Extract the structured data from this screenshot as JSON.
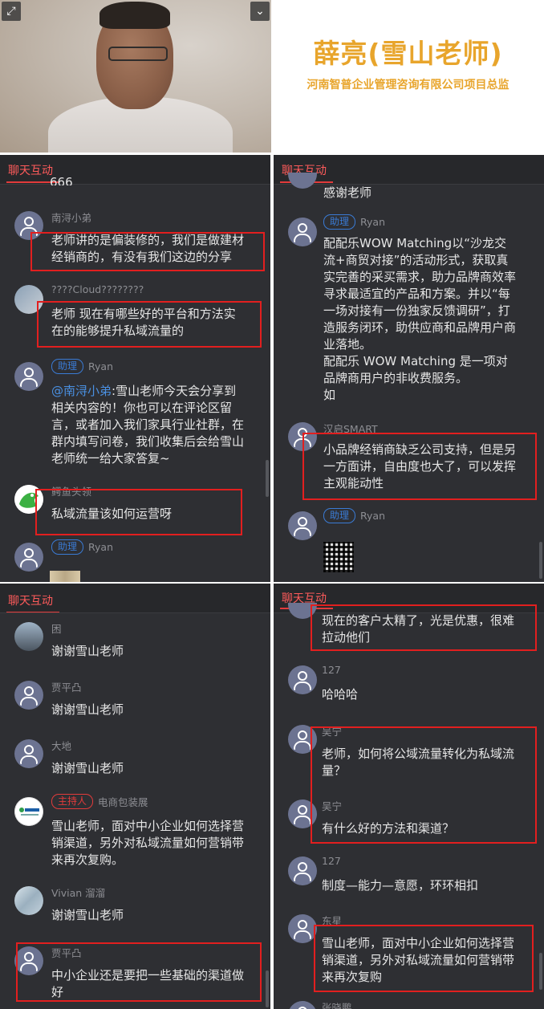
{
  "video": {
    "expand_icon": "⤢",
    "collapse_icon": "⌄"
  },
  "title": {
    "name": "薛亮(雪山老师)",
    "subtitle": "河南智普企业管理咨询有限公司项目总监"
  },
  "panel_label": "聊天互动",
  "panel1": {
    "partial_top": "666",
    "messages": [
      {
        "user": "南浔小弟",
        "text": [
          "老师讲的是偏装修的，我们是做建材",
          "经销商的，有没有我们这边的分享"
        ]
      },
      {
        "user": "????Cloud????????",
        "text": [
          "老师 现在有哪些好的平台和方法实",
          "在的能够提升私域流量的"
        ]
      },
      {
        "badge": "助理",
        "user": "Ryan",
        "mention": "@南浔小弟",
        "text_first": ":雪山老师今天会分享到",
        "text": [
          "相关内容的！你也可以在评论区留",
          "言，或者加入我们家具行业社群，在",
          "群内填写问卷，我们收集后会给雪山",
          "老师统一给大家答复~"
        ]
      },
      {
        "user": "鳄鱼头领",
        "text": [
          "私域流量该如何运营呀"
        ]
      },
      {
        "badge": "助理",
        "user": "Ryan"
      }
    ]
  },
  "panel2": {
    "partial_top": "感谢老师",
    "messages": [
      {
        "badge": "助理",
        "user": "Ryan",
        "text": [
          "配配乐WOW Matching以“沙龙交",
          "流+商贸对接”的活动形式，获取真",
          "实完善的采买需求，助力品牌商效率",
          "寻求最适宜的产品和方案。并以“每",
          "一场对接有一份独家反馈调研”，打",
          "造服务闭环，助供应商和品牌用户商",
          "业落地。",
          "配配乐 WOW Matching 是一项对",
          "品牌商用户的非收费服务。",
          "如"
        ]
      },
      {
        "user": "汉启SMART",
        "text": [
          "小品牌经销商缺乏公司支持，但是另",
          "一方面讲，自由度也大了，可以发挥",
          "主观能动性"
        ]
      },
      {
        "badge": "助理",
        "user": "Ryan"
      }
    ]
  },
  "panel3": {
    "messages": [
      {
        "user": "困",
        "text": [
          "谢谢雪山老师"
        ]
      },
      {
        "user": "贾平凸",
        "text": [
          "谢谢雪山老师"
        ]
      },
      {
        "user": "大地",
        "text": [
          "谢谢雪山老师"
        ]
      },
      {
        "badge": "主持人",
        "user": "电商包装展",
        "text": [
          "雪山老师，面对中小企业如何选择营",
          "销渠道，另外对私域流量如何营销带",
          "来再次复购。"
        ]
      },
      {
        "user": "Vivian 溜溜",
        "text": [
          "谢谢雪山老师"
        ]
      },
      {
        "user": "贾平凸",
        "text": [
          "中小企业还是要把一些基础的渠道做",
          "好"
        ]
      }
    ]
  },
  "panel4": {
    "messages": [
      {
        "text": [
          "现在的客户太精了，光是优惠，很难",
          "拉动他们"
        ]
      },
      {
        "user": "127",
        "text": [
          "哈哈哈"
        ]
      },
      {
        "user": "吴宁",
        "text": [
          "老师，如何将公域流量转化为私域流",
          "量？"
        ]
      },
      {
        "user": "吴宁",
        "text": [
          "有什么好的方法和渠道？"
        ]
      },
      {
        "user": "127",
        "text": [
          "制度—能力—意愿，环环相扣"
        ]
      },
      {
        "user": "东星",
        "text": [
          "雪山老师，面对中小企业如何选择营",
          "销渠道，另外对私域流量如何营销带",
          "来再次复购"
        ]
      },
      {
        "user": "张晓鹏"
      }
    ]
  }
}
